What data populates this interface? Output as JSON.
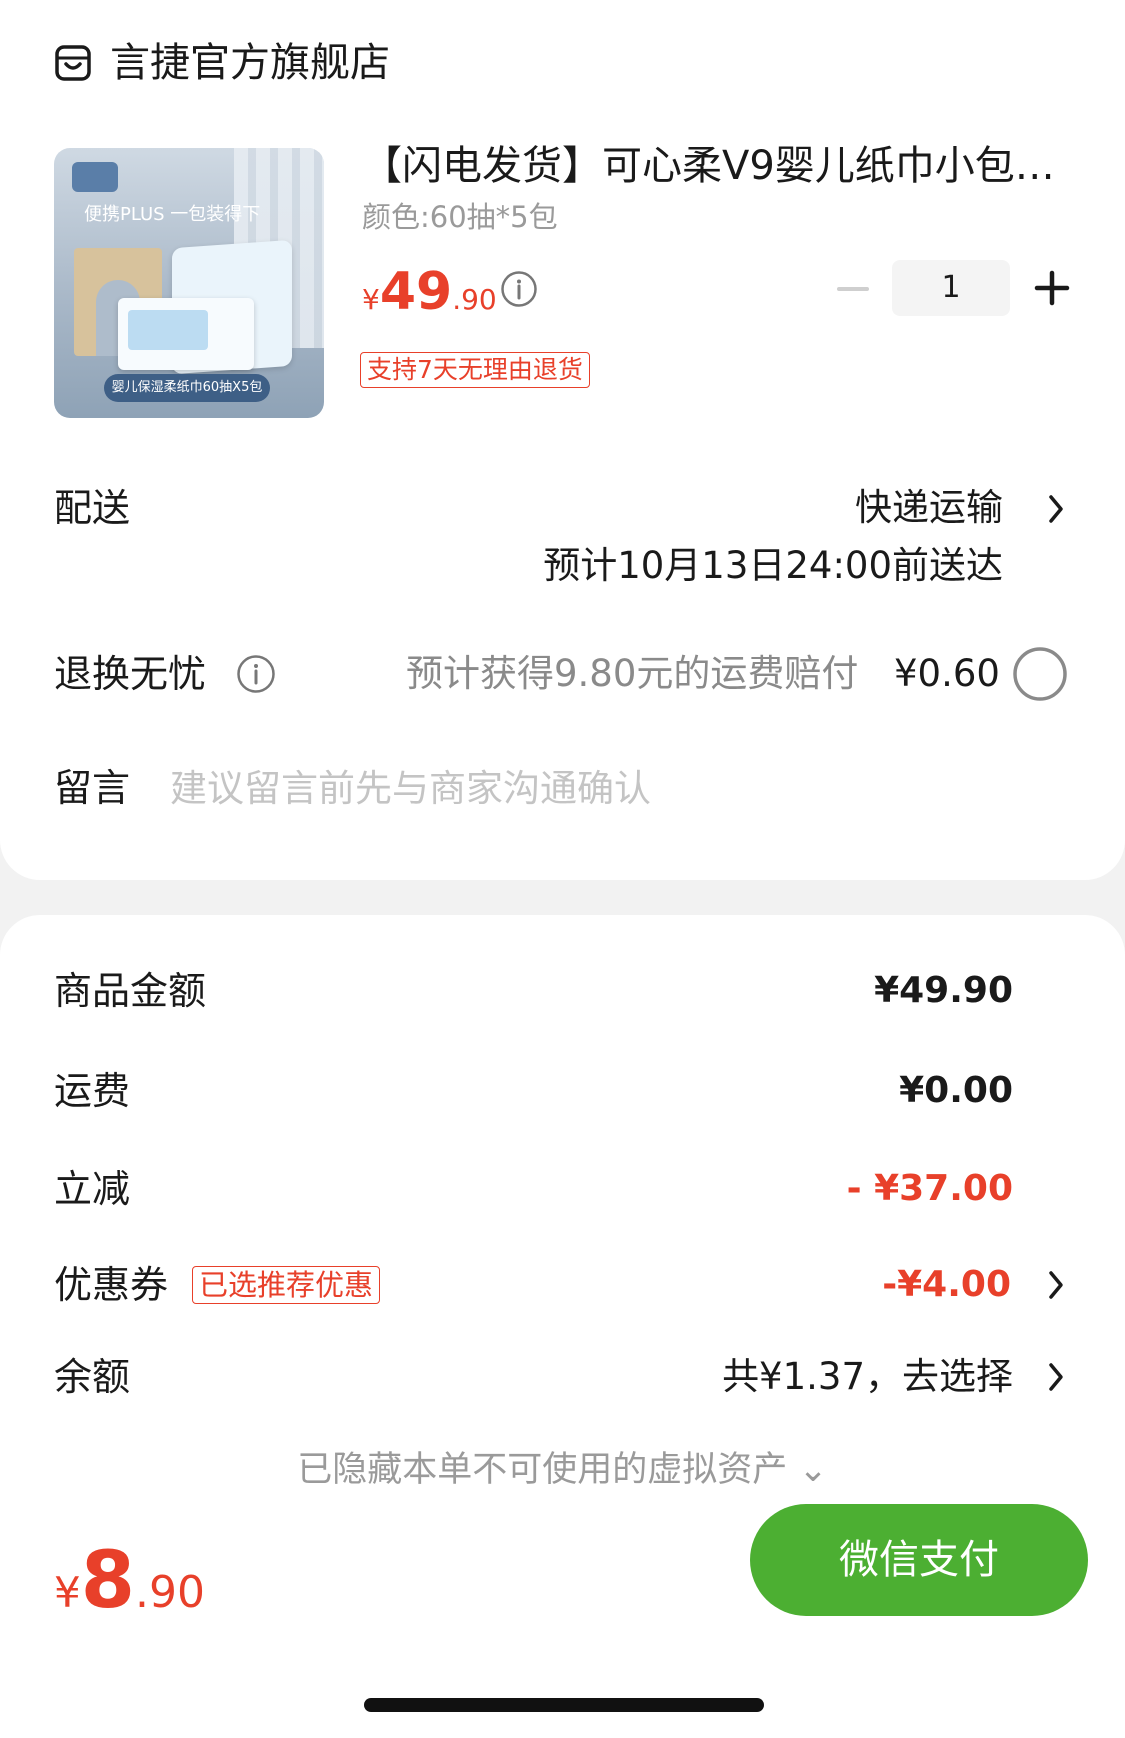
{
  "store": {
    "name": "言捷官方旗舰店",
    "icon": "store-icon"
  },
  "product": {
    "title": "【闪电发货】可心柔V9婴儿纸巾小包…",
    "spec": "颜色:60抽*5包",
    "price_currency": "¥",
    "price_integer": "49",
    "price_decimal": ".90",
    "quantity": "1",
    "return_policy": "支持7天无理由退货",
    "image_tagline": "便携PLUS 一包装得下",
    "image_caption": "婴儿保湿柔纸巾60抽X5包"
  },
  "delivery": {
    "label": "配送",
    "method": "快递运输",
    "eta": "预计10月13日24:00前送达"
  },
  "return_insurance": {
    "label": "退换无忧",
    "compensation_text": "预计获得9.80元的运费赔付",
    "price": "¥0.60"
  },
  "message": {
    "label": "留言",
    "placeholder": "建议留言前先与商家沟通确认"
  },
  "summary": {
    "goods_label": "商品金额",
    "goods_value": "¥49.90",
    "shipping_label": "运费",
    "shipping_value": "¥0.00",
    "discount_label": "立减",
    "discount_value": "- ¥37.00",
    "coupon_label": "优惠券",
    "coupon_badge": "已选推荐优惠",
    "coupon_value": "-¥4.00",
    "balance_label": "余额",
    "balance_value": "共¥1.37，去选择",
    "hidden_assets": "已隐藏本单不可使用的虚拟资产 ⌄"
  },
  "footer": {
    "total_currency": "¥",
    "total_integer": "8",
    "total_decimal": ".90",
    "pay_button": "微信支付"
  },
  "colors": {
    "accent_red": "#e8402a",
    "pay_green": "#4caf32",
    "background": "#f2f2f2"
  }
}
